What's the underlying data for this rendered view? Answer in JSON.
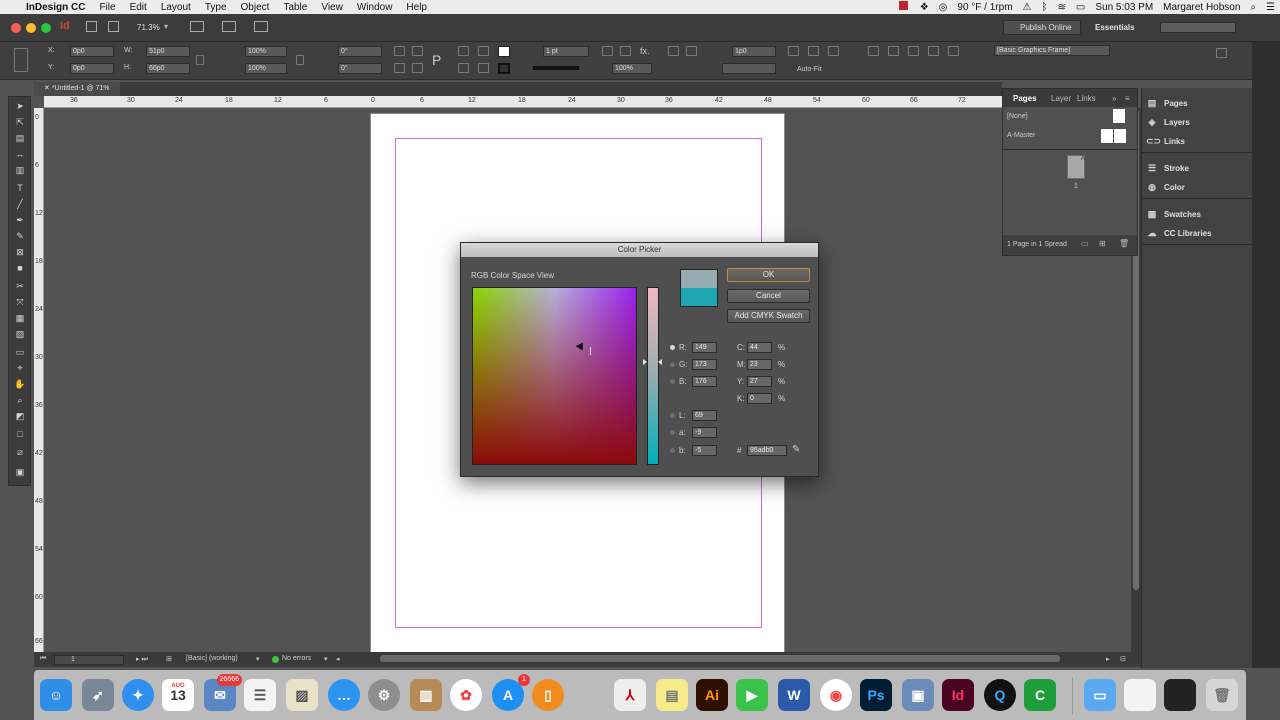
{
  "menubar": {
    "apple": "",
    "app_name": "InDesign CC",
    "menus": [
      "File",
      "Edit",
      "Layout",
      "Type",
      "Object",
      "Table",
      "View",
      "Window",
      "Help"
    ],
    "weather": "90 °F / 1rpm",
    "clock": "Sun 5:03 PM",
    "user": "Margaret Hobson"
  },
  "titlebar": {
    "zoom": "71.3%",
    "publish_label": "Publish Online",
    "workspace": "Essentials"
  },
  "control": {
    "x": "0p0",
    "y": "0p0",
    "w": "51p0",
    "h": "66p0",
    "scale_x": "100%",
    "scale_y": "100%",
    "angle": "0°",
    "shear": "0°",
    "stroke_weight": "1 pt",
    "opacity": "100%",
    "frame_offset": "1p0",
    "style": "[Basic Graphics Frame]",
    "autofit": "Auto-Fit"
  },
  "document": {
    "tab": "*Untitled-1 @ 71%",
    "ruler_top": [
      "36",
      "30",
      "24",
      "18",
      "12",
      "6",
      "0",
      "6",
      "12",
      "18",
      "24",
      "30",
      "36",
      "42",
      "48",
      "54",
      "60",
      "66",
      "72"
    ],
    "ruler_left": [
      "0",
      "6",
      "12",
      "18",
      "24",
      "30",
      "36",
      "42",
      "48",
      "54",
      "60",
      "66"
    ]
  },
  "status": {
    "page": "1",
    "style": "[Basic] (working)",
    "errors": "No errors"
  },
  "pages_panel": {
    "tabs": [
      "Pages",
      "Layers",
      "Links"
    ],
    "none_label": "[None]",
    "master_label": "A-Master",
    "page_number": "1",
    "master_letter": "A",
    "footer": "1 Page in 1 Spread"
  },
  "dock_panels": [
    "Pages",
    "Layers",
    "Links",
    "Stroke",
    "Color",
    "Swatches",
    "CC Libraries"
  ],
  "color_picker": {
    "title": "Color Picker",
    "view_label": "RGB Color Space View",
    "ok": "OK",
    "cancel": "Cancel",
    "add_swatch": "Add CMYK Swatch",
    "R": "149",
    "G": "173",
    "B": "176",
    "L": "69",
    "a": "-9",
    "b": "-5",
    "C": "44",
    "M": "23",
    "Y": "27",
    "K": "0",
    "hex": "95adb0",
    "pct": "%",
    "hash": "#",
    "lbl_R": "R:",
    "lbl_G": "G:",
    "lbl_B": "B:",
    "lbl_L": "L:",
    "lbl_a": "a:",
    "lbl_b": "b:",
    "lbl_C": "C:",
    "lbl_M": "M:",
    "lbl_Y": "Y:",
    "lbl_K": "K:",
    "new_color": "#95adb0",
    "old_color": "#1fa6b3"
  },
  "dock": {
    "calendar_month": "AUG",
    "calendar_day": "13",
    "mail_badge": "26666",
    "appstore_badge": "1",
    "illustrator": "Ai",
    "photoshop": "Ps",
    "indesign": "Id",
    "word": "W"
  }
}
